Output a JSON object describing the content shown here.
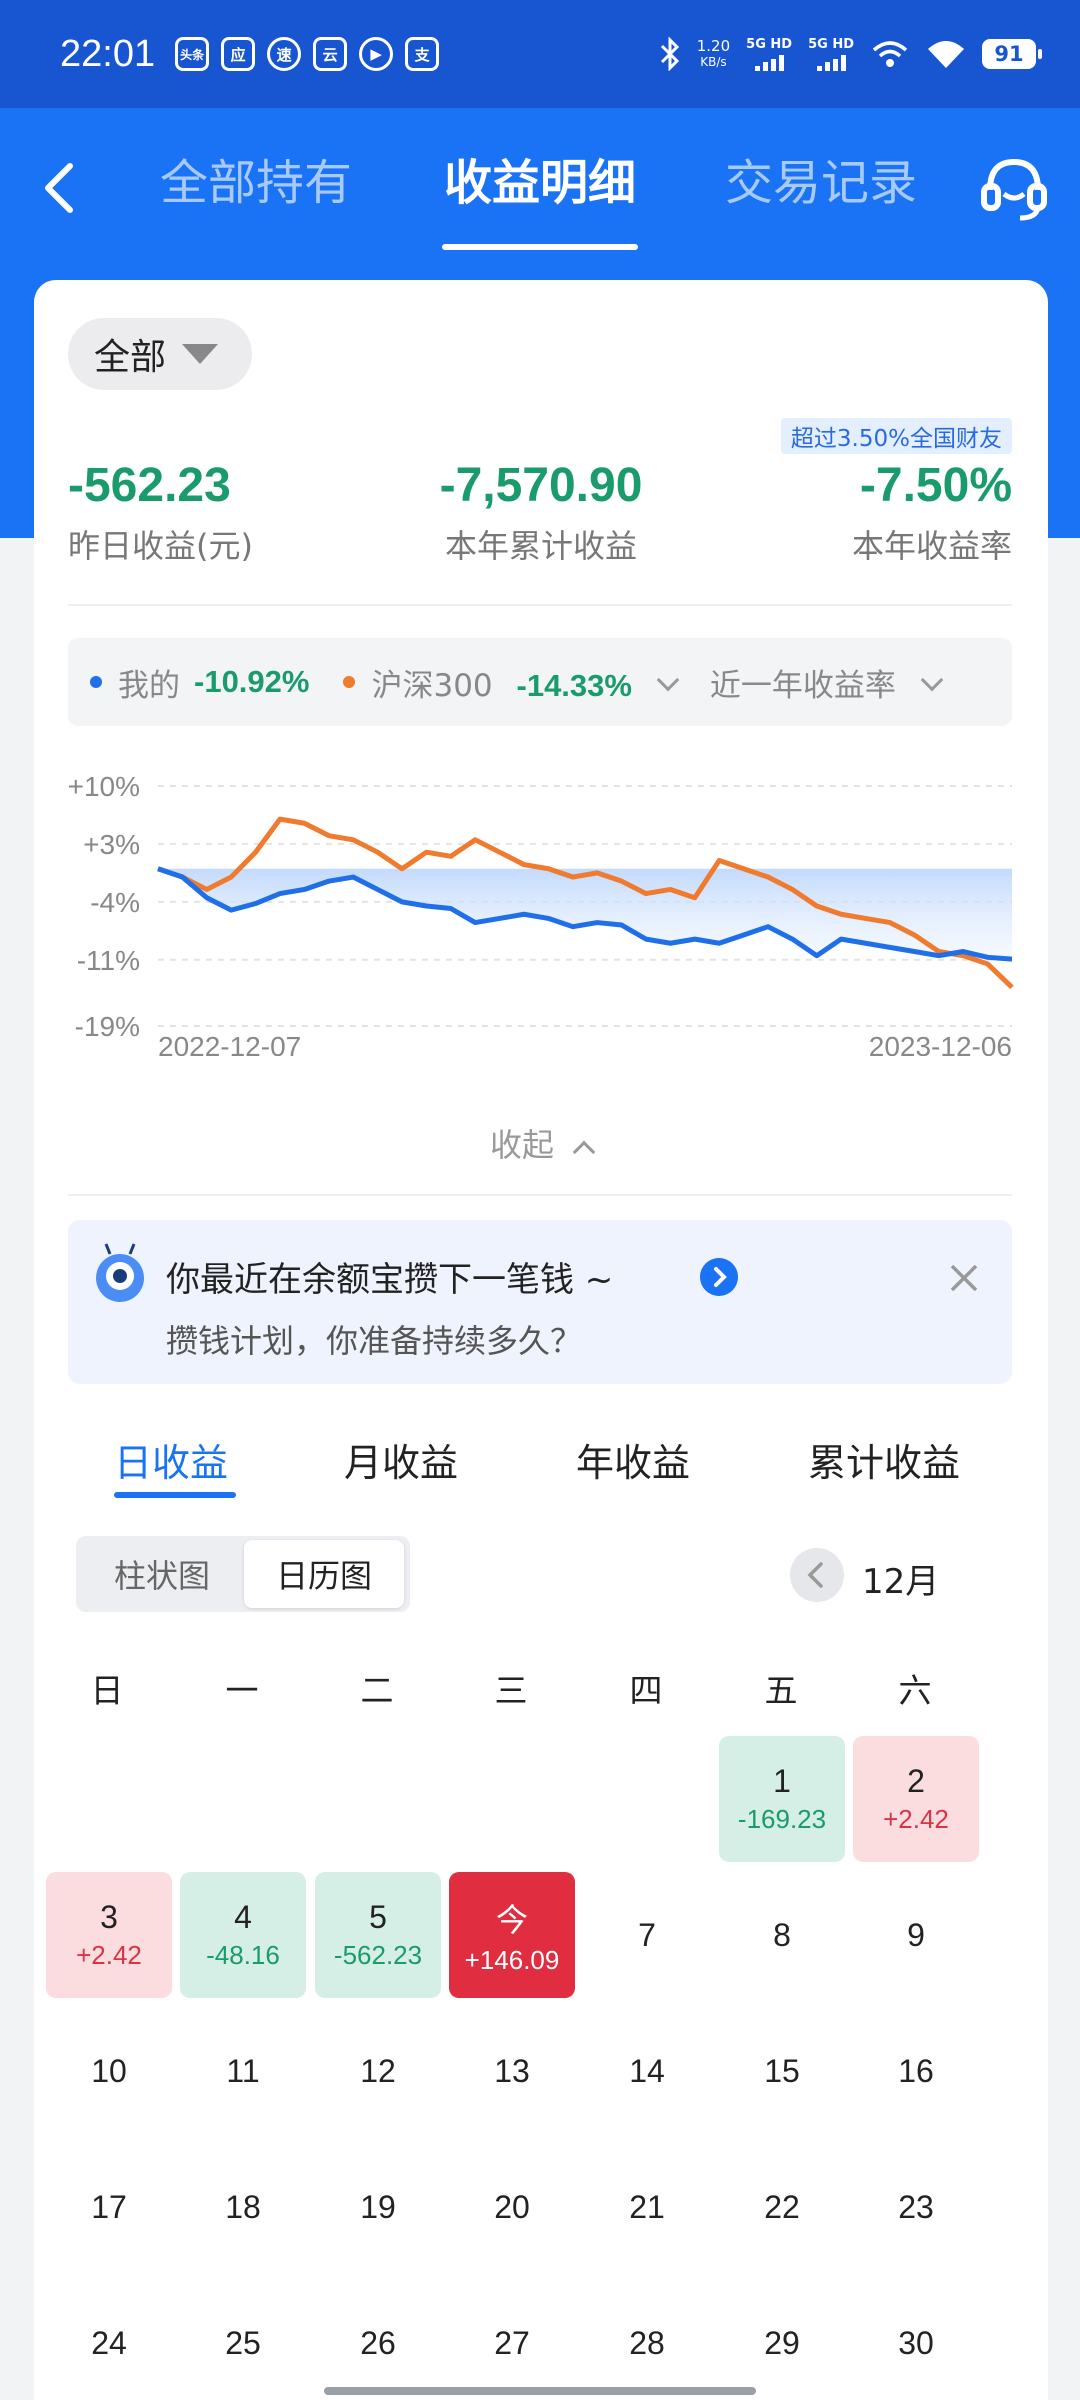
{
  "status_bar": {
    "time": "22:01",
    "app_icons": [
      "头条",
      "应",
      "速",
      "云",
      "播",
      "支"
    ],
    "net_speed_value": "1.20",
    "net_speed_unit": "KB/s",
    "sim1": "5G HD",
    "sim2": "5G HD",
    "battery": "91"
  },
  "nav": {
    "tabs": [
      {
        "label": "全部持有",
        "active": false
      },
      {
        "label": "收益明细",
        "active": true
      },
      {
        "label": "交易记录",
        "active": false
      }
    ]
  },
  "filter": {
    "label": "全部"
  },
  "summary": {
    "rank_badge": "超过3.50%全国财友",
    "yesterday_value": "-562.23",
    "yesterday_label": "昨日收益(元)",
    "ytd_value": "-7,570.90",
    "ytd_label": "本年累计收益",
    "ytd_rate_value": "-7.50%",
    "ytd_rate_label": "本年收益率"
  },
  "legend": {
    "mine_label": "我的",
    "mine_value": "-10.92%",
    "index_label": "沪深300",
    "index_value": "-14.33%",
    "range_label": "近一年收益率"
  },
  "chart_data": {
    "type": "line",
    "yticks": [
      "+10%",
      "+3%",
      "-4%",
      "-11%",
      "-19%"
    ],
    "ylim": [
      -19,
      10
    ],
    "x_start": "2022-12-07",
    "x_end": "2023-12-06",
    "series": [
      {
        "name": "我的",
        "color": "#1f6fe8",
        "values": [
          0.0,
          -1.0,
          -3.5,
          -5.0,
          -4.2,
          -3.0,
          -2.5,
          -1.5,
          -1.0,
          -2.5,
          -4.0,
          -4.5,
          -4.8,
          -6.5,
          -6.0,
          -5.5,
          -6.0,
          -7.0,
          -6.5,
          -6.8,
          -8.5,
          -9.0,
          -8.5,
          -9.0,
          -8.0,
          -7.0,
          -8.5,
          -10.5,
          -8.5,
          -9.0,
          -9.5,
          -10.0,
          -10.5,
          -10.0,
          -10.7,
          -10.92
        ]
      },
      {
        "name": "沪深300",
        "color": "#f07a2d",
        "values": [
          0.0,
          -1.0,
          -2.5,
          -1.0,
          2.0,
          6.0,
          5.5,
          4.0,
          3.5,
          2.0,
          0.0,
          2.0,
          1.5,
          3.5,
          2.0,
          0.5,
          0.0,
          -1.0,
          -0.5,
          -1.5,
          -3.0,
          -2.5,
          -3.5,
          1.0,
          0.0,
          -1.0,
          -2.5,
          -4.5,
          -5.5,
          -6.0,
          -6.5,
          -8.0,
          -10.0,
          -10.5,
          -11.5,
          -14.33
        ]
      }
    ]
  },
  "collapse_label": "收起",
  "promo": {
    "title": "你最近在余额宝攒下一笔钱 ~",
    "subtitle": "攒钱计划，你准备持续多久？"
  },
  "period_tabs": [
    {
      "label": "日收益",
      "active": true
    },
    {
      "label": "月收益",
      "active": false
    },
    {
      "label": "年收益",
      "active": false
    },
    {
      "label": "累计收益",
      "active": false
    }
  ],
  "view_toggle": {
    "bar_label": "柱状图",
    "calendar_label": "日历图",
    "selected": "日历图"
  },
  "month_label": "12月",
  "weekdays": [
    "日",
    "一",
    "二",
    "三",
    "四",
    "五",
    "六"
  ],
  "calendar_days": [
    {
      "day": "1",
      "value": "-169.23",
      "kind": "loss"
    },
    {
      "day": "2",
      "value": "+2.42",
      "kind": "gain"
    },
    {
      "day": "3",
      "value": "+2.42",
      "kind": "gain"
    },
    {
      "day": "4",
      "value": "-48.16",
      "kind": "loss"
    },
    {
      "day": "5",
      "value": "-562.23",
      "kind": "loss"
    },
    {
      "day": "今",
      "value": "+146.09",
      "kind": "today"
    },
    {
      "day": "7",
      "value": "",
      "kind": "none"
    },
    {
      "day": "8",
      "value": "",
      "kind": "none"
    },
    {
      "day": "9",
      "value": "",
      "kind": "none"
    },
    {
      "day": "10",
      "value": "",
      "kind": "none"
    },
    {
      "day": "11",
      "value": "",
      "kind": "none"
    },
    {
      "day": "12",
      "value": "",
      "kind": "none"
    },
    {
      "day": "13",
      "value": "",
      "kind": "none"
    },
    {
      "day": "14",
      "value": "",
      "kind": "none"
    },
    {
      "day": "15",
      "value": "",
      "kind": "none"
    },
    {
      "day": "16",
      "value": "",
      "kind": "none"
    },
    {
      "day": "17",
      "value": "",
      "kind": "none"
    },
    {
      "day": "18",
      "value": "",
      "kind": "none"
    },
    {
      "day": "19",
      "value": "",
      "kind": "none"
    },
    {
      "day": "20",
      "value": "",
      "kind": "none"
    },
    {
      "day": "21",
      "value": "",
      "kind": "none"
    },
    {
      "day": "22",
      "value": "",
      "kind": "none"
    },
    {
      "day": "23",
      "value": "",
      "kind": "none"
    },
    {
      "day": "24",
      "value": "",
      "kind": "none"
    },
    {
      "day": "25",
      "value": "",
      "kind": "none"
    },
    {
      "day": "26",
      "value": "",
      "kind": "none"
    },
    {
      "day": "27",
      "value": "",
      "kind": "none"
    },
    {
      "day": "28",
      "value": "",
      "kind": "none"
    },
    {
      "day": "29",
      "value": "",
      "kind": "none"
    },
    {
      "day": "30",
      "value": "",
      "kind": "none"
    }
  ]
}
